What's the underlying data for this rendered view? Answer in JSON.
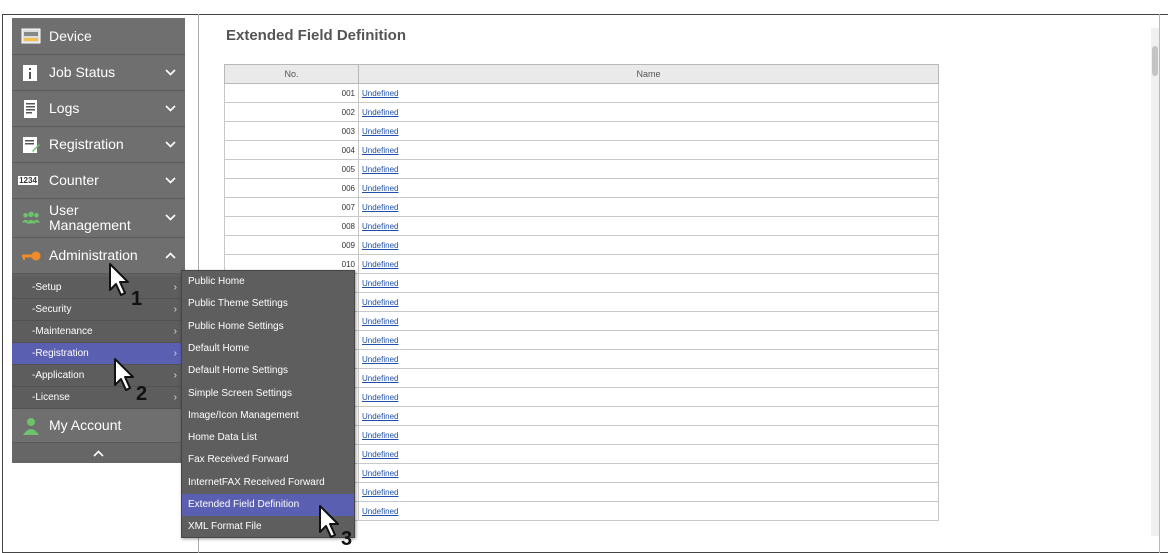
{
  "sidebar": {
    "items": [
      {
        "label": "Device",
        "icon": "device-icon",
        "chevron": ""
      },
      {
        "label": "Job Status",
        "icon": "job-status-icon",
        "chevron": "⌄"
      },
      {
        "label": "Logs",
        "icon": "logs-icon",
        "chevron": "⌄"
      },
      {
        "label": "Registration",
        "icon": "registration-icon",
        "chevron": "⌄"
      },
      {
        "label": "Counter",
        "icon": "counter-icon",
        "chevron": "⌄"
      },
      {
        "label": "User\nManagement",
        "icon": "user-management-icon",
        "chevron": "⌄"
      },
      {
        "label": "Administration",
        "icon": "key-icon",
        "chevron": "^"
      }
    ],
    "counter_icon_text": "1234",
    "sub_items": [
      {
        "label": "-Setup"
      },
      {
        "label": "-Security"
      },
      {
        "label": "-Maintenance"
      },
      {
        "label": "-Registration"
      },
      {
        "label": "-Application"
      },
      {
        "label": "-License"
      }
    ],
    "my_account": "My Account",
    "collapse": "^"
  },
  "main": {
    "title": "Extended Field Definition",
    "table": {
      "headers": [
        "No.",
        "Name"
      ],
      "rows": [
        {
          "no": "001",
          "name": "Undefined"
        },
        {
          "no": "002",
          "name": "Undefined"
        },
        {
          "no": "003",
          "name": "Undefined"
        },
        {
          "no": "004",
          "name": "Undefined"
        },
        {
          "no": "005",
          "name": "Undefined"
        },
        {
          "no": "006",
          "name": "Undefined"
        },
        {
          "no": "007",
          "name": "Undefined"
        },
        {
          "no": "008",
          "name": "Undefined"
        },
        {
          "no": "009",
          "name": "Undefined"
        },
        {
          "no": "010",
          "name": "Undefined"
        },
        {
          "no": "",
          "name": "Undefined"
        },
        {
          "no": "",
          "name": "Undefined"
        },
        {
          "no": "",
          "name": "Undefined"
        },
        {
          "no": "",
          "name": "Undefined"
        },
        {
          "no": "",
          "name": "Undefined"
        },
        {
          "no": "",
          "name": "Undefined"
        },
        {
          "no": "",
          "name": "Undefined"
        },
        {
          "no": "",
          "name": "Undefined"
        },
        {
          "no": "",
          "name": "Undefined"
        },
        {
          "no": "",
          "name": "Undefined"
        },
        {
          "no": "",
          "name": "Undefined"
        },
        {
          "no": "",
          "name": "Undefined"
        },
        {
          "no": "",
          "name": "Undefined"
        }
      ]
    }
  },
  "popup": {
    "items": [
      "Public Home",
      "Public Theme Settings",
      "Public Home Settings",
      "Default Home",
      "Default Home Settings",
      "Simple Screen Settings",
      "Image/Icon Management",
      "Home Data List",
      "Fax Received Forward",
      "InternetFAX Received Forward",
      "Extended Field Definition",
      "XML Format File"
    ],
    "selected_index": 10
  },
  "callouts": [
    "1",
    "2",
    "3"
  ],
  "colors": {
    "sidebar_bg": "#6f6f6f",
    "selected": "#5b5fb2",
    "link": "#1f4fa8",
    "icon_green": "#6cc36c",
    "icon_orange": "#f08c28"
  }
}
